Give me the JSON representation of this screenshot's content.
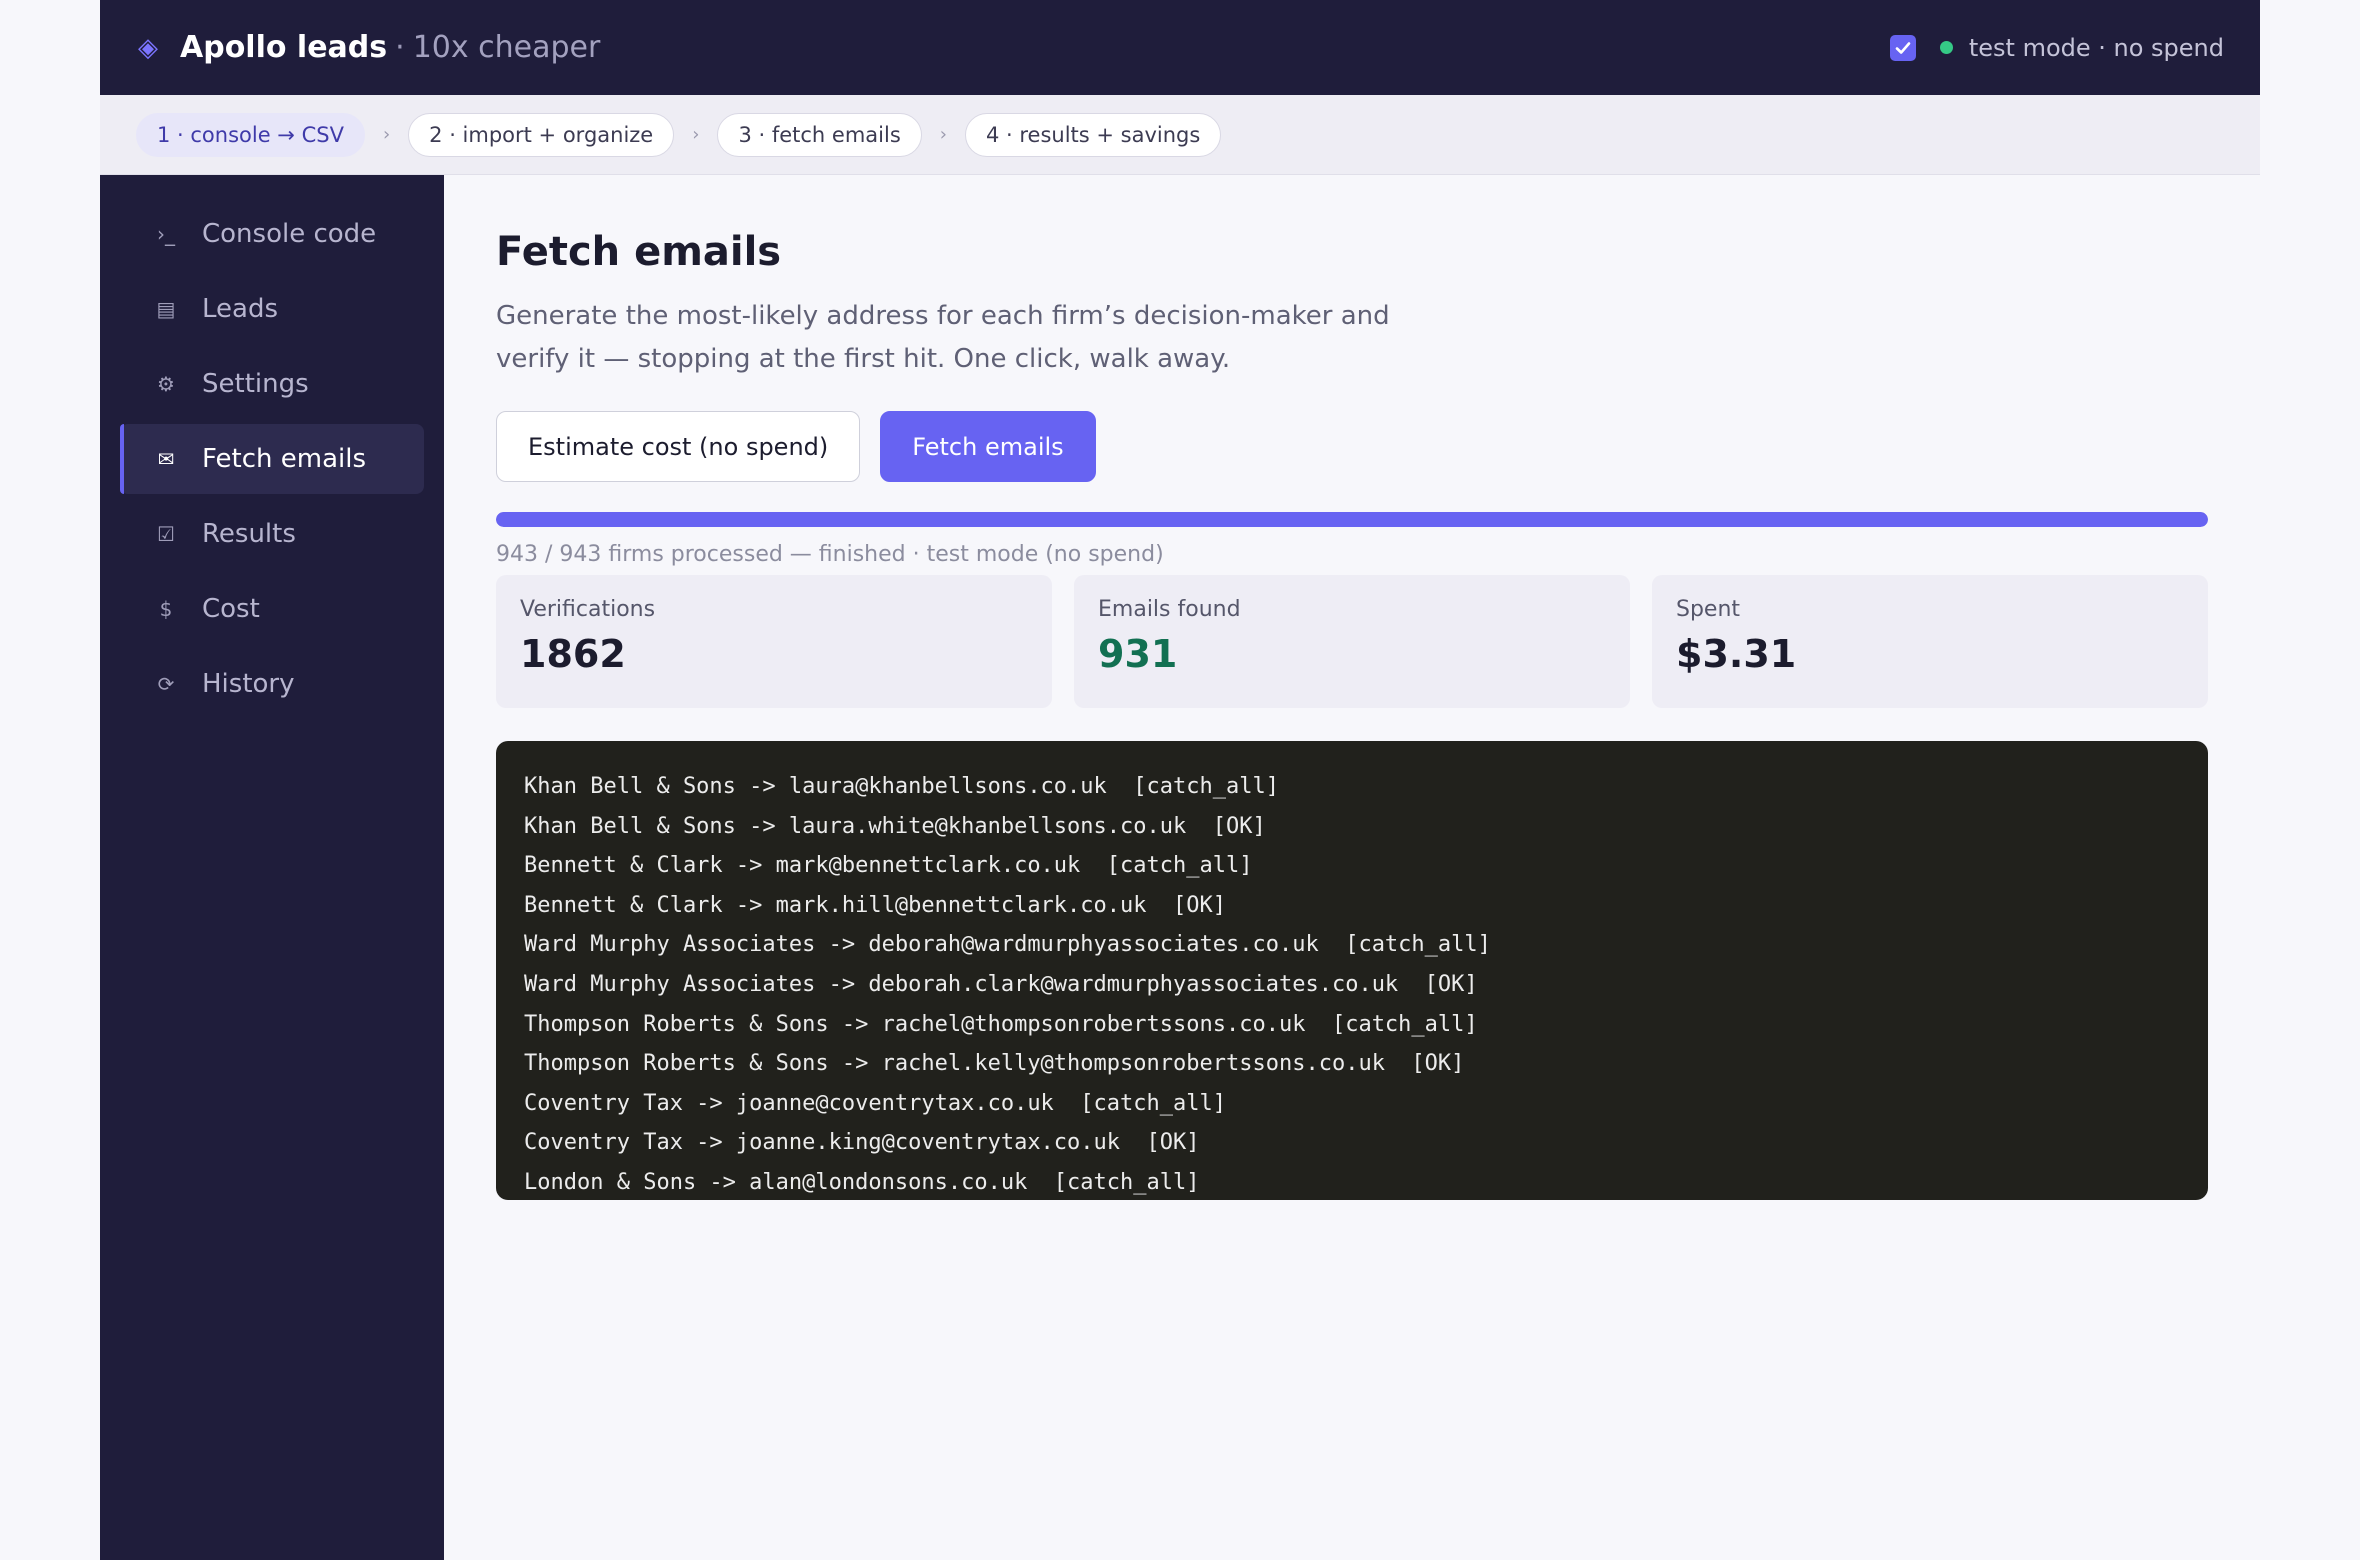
{
  "header": {
    "brand_name": "Apollo leads",
    "brand_separator": "·",
    "brand_tagline": "10x cheaper",
    "test_mode_checked": true,
    "mode_text": "test mode · no spend"
  },
  "steps": [
    {
      "label": "1 · console → CSV",
      "active": true
    },
    {
      "label": "2 · import + organize",
      "active": false
    },
    {
      "label": "3 · fetch emails",
      "active": false
    },
    {
      "label": "4 · results + savings",
      "active": false
    }
  ],
  "step_arrow": "›",
  "sidebar": {
    "items": [
      {
        "icon": "terminal-icon",
        "glyph": "›_",
        "label": "Console code",
        "active": false
      },
      {
        "icon": "list-icon",
        "glyph": "▤",
        "label": "Leads",
        "active": false
      },
      {
        "icon": "gear-icon",
        "glyph": "⚙",
        "label": "Settings",
        "active": false
      },
      {
        "icon": "mail-icon",
        "glyph": "✉",
        "label": "Fetch emails",
        "active": true
      },
      {
        "icon": "checkbox-icon",
        "glyph": "☑",
        "label": "Results",
        "active": false
      },
      {
        "icon": "dollar-icon",
        "glyph": "$",
        "label": "Cost",
        "active": false
      },
      {
        "icon": "history-icon",
        "glyph": "⟳",
        "label": "History",
        "active": false
      }
    ]
  },
  "main": {
    "title": "Fetch emails",
    "description_line1": "Generate the most-likely address for each firm’s decision-maker and",
    "description_line2": "verify it — stopping at the first hit. One click, walk away.",
    "estimate_button": "Estimate cost (no spend)",
    "fetch_button": "Fetch emails",
    "progress_fraction": 1.0,
    "progress_text": "943 / 943 firms processed — finished · test mode (no spend)",
    "stats": [
      {
        "label": "Verifications",
        "value": "1862",
        "highlight": false
      },
      {
        "label": "Emails found",
        "value": "931",
        "highlight": true
      },
      {
        "label": "Spent",
        "value": "$3.31",
        "highlight": false
      }
    ],
    "log_lines": [
      "Khan Bell & Sons -> laura@khanbellsons.co.uk  [catch_all]",
      "Khan Bell & Sons -> laura.white@khanbellsons.co.uk  [OK]",
      "Bennett & Clark -> mark@bennettclark.co.uk  [catch_all]",
      "Bennett & Clark -> mark.hill@bennettclark.co.uk  [OK]",
      "Ward Murphy Associates -> deborah@wardmurphyassociates.co.uk  [catch_all]",
      "Ward Murphy Associates -> deborah.clark@wardmurphyassociates.co.uk  [OK]",
      "Thompson Roberts & Sons -> rachel@thompsonrobertssons.co.uk  [catch_all]",
      "Thompson Roberts & Sons -> rachel.kelly@thompsonrobertssons.co.uk  [OK]",
      "Coventry Tax -> joanne@coventrytax.co.uk  [catch_all]",
      "Coventry Tax -> joanne.king@coventrytax.co.uk  [OK]",
      "London & Sons -> alan@londonsons.co.uk  [catch_all]"
    ]
  },
  "colors": {
    "accent": "#6763f2",
    "sidebar_bg": "#1f1d3b",
    "success": "#127052",
    "status_dot": "#35c986",
    "log_bg": "#21211c"
  }
}
